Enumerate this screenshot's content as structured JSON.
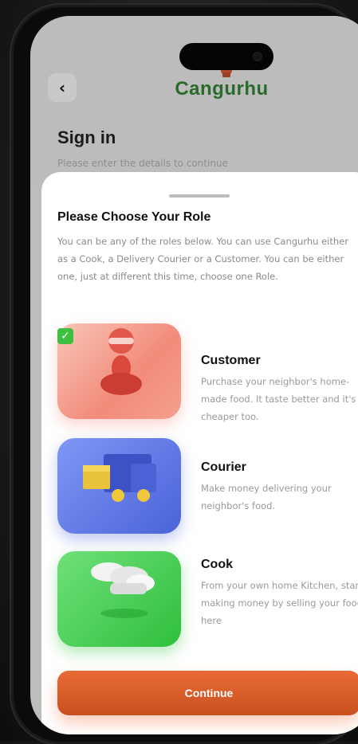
{
  "header": {
    "app_name": "Cangurhu",
    "title": "Sign in",
    "subtitle": "Please enter the details to continue",
    "back_icon": "chevron-left-icon"
  },
  "sheet": {
    "title": "Please Choose Your Role",
    "description": "You can be any of the roles below. You can use Cangurhu either as a Cook, a Delivery Courier or a Customer. You can be either one, just at different this time, choose one Role.",
    "roles": [
      {
        "name": "Customer",
        "description": "Purchase your neighbor's home-made food. It taste better and it's cheaper too.",
        "selected": true,
        "color": "#f28b7a"
      },
      {
        "name": "Courier",
        "description": "Make money delivering your neighbor's food.",
        "selected": false,
        "color": "#5d78e8"
      },
      {
        "name": "Cook",
        "description": "From your own home Kitchen, start making money by selling your food here",
        "selected": false,
        "color": "#3ccf4a"
      }
    ],
    "continue_label": "Continue"
  },
  "colors": {
    "brand_green": "#2a6a2a",
    "accent_orange": "#e86b35",
    "check_green": "#3fbf3f"
  }
}
